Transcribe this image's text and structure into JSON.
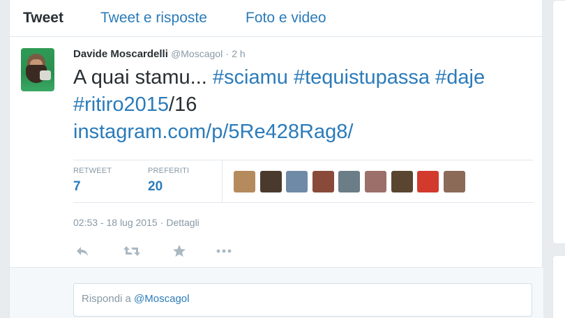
{
  "tabs": [
    {
      "label": "Tweet",
      "active": true
    },
    {
      "label": "Tweet e risposte",
      "active": false
    },
    {
      "label": "Foto e video",
      "active": false
    }
  ],
  "tweet": {
    "author_name": "Davide Moscardelli",
    "author_handle": "@Moscagol",
    "separator": "·",
    "time_ago": "2 h",
    "text_plain_1": "A quai stamu... ",
    "hashtag_1": "#sciamu",
    "hashtag_2": "#tequistupassa",
    "hashtag_3": "#daje",
    "hashtag_4": "#ritiro2015",
    "text_plain_2": "/16",
    "link": "instagram.com/p/5Re428Rag8/"
  },
  "stats": {
    "retweet_label": "RETWEET",
    "retweet_count": "7",
    "fav_label": "PREFERITI",
    "fav_count": "20",
    "fav_avatar_colors": [
      "#b58a5c",
      "#4a3a2e",
      "#6f8aa6",
      "#8a4a3a",
      "#6b7d86",
      "#9c6f6a",
      "#5a4630",
      "#d23a2e",
      "#8c6a58"
    ]
  },
  "timestamp": {
    "time": "02:53 - 18 lug 2015",
    "separator": "·",
    "details_label": "Dettagli"
  },
  "actions": {
    "reply_icon": "reply-icon",
    "retweet_icon": "retweet-icon",
    "favorite_icon": "star-icon",
    "more_icon": "more-icon"
  },
  "reply": {
    "prefix": "Rispondi a ",
    "mention": "@Moscagol"
  },
  "colors": {
    "link": "#2b7bb9",
    "muted": "#8899a6",
    "text": "#292f33"
  }
}
